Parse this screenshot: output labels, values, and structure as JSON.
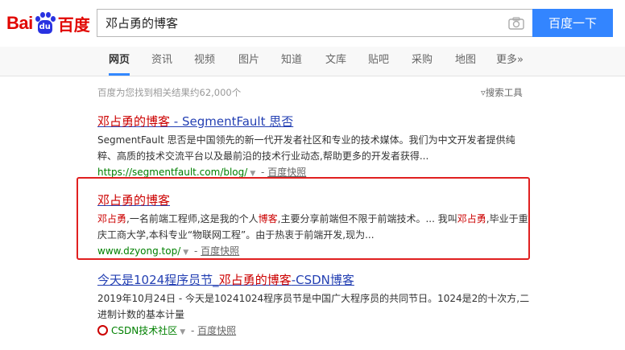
{
  "logo": {
    "part1": "Bai",
    "part2": "du",
    "paw_text": "du",
    "cn": "百度"
  },
  "search": {
    "query": "邓占勇的博客",
    "button_label": "百度一下"
  },
  "tabs": [
    "网页",
    "资讯",
    "视频",
    "图片",
    "知道",
    "文库",
    "贴吧",
    "采购",
    "地图",
    "更多»"
  ],
  "meta": {
    "count_text": "百度为您找到相关结果约62,000个",
    "tools_label": "搜索工具"
  },
  "results": [
    {
      "title_hl": "邓占勇的博客",
      "title_rest": " - SegmentFault 思否",
      "abs": "SegmentFault 思否是中国领先的新一代开发者社区和专业的技术媒体。我们为中文开发者提供纯粹、高质的技术交流平台以及最前沿的技术行业动态,帮助更多的开发者获得...",
      "url": "https://segmentfault.com/blog/",
      "snapshot": "百度快照"
    },
    {
      "title_hl": "邓占勇的博客",
      "abs_p1_hl": "邓占勇",
      "abs_p2": ",一名前端工程师,这是我的个人",
      "abs_p3_hl": "博客",
      "abs_p4": ",主要分享前端但不限于前端技术。... 我叫",
      "abs_p5_hl": "邓占勇",
      "abs_p6": ",毕业于重庆工商大学,本科专业“物联网工程”。由于热衷于前端开发,现为...",
      "url": "www.dzyong.top/",
      "snapshot": "百度快照"
    },
    {
      "title_pre": "今天是1024程序员节_",
      "title_hl": "邓占勇的博客",
      "title_rest": "-CSDN博客",
      "abs": "2019年10月24日 - 今天是10241024程序员节是中国广大程序员的共同节日。1024是2的十次方,二进制计数的基本计量",
      "url": "CSDN技术社区",
      "snapshot": "百度快照"
    }
  ],
  "colors": {
    "brand_red": "#e10601",
    "brand_blue": "#2932e1",
    "button_blue": "#3385ff",
    "link_blue": "#2440b3",
    "highlight_red": "#c00",
    "url_green": "#008000",
    "annotation_red": "#e02020"
  }
}
